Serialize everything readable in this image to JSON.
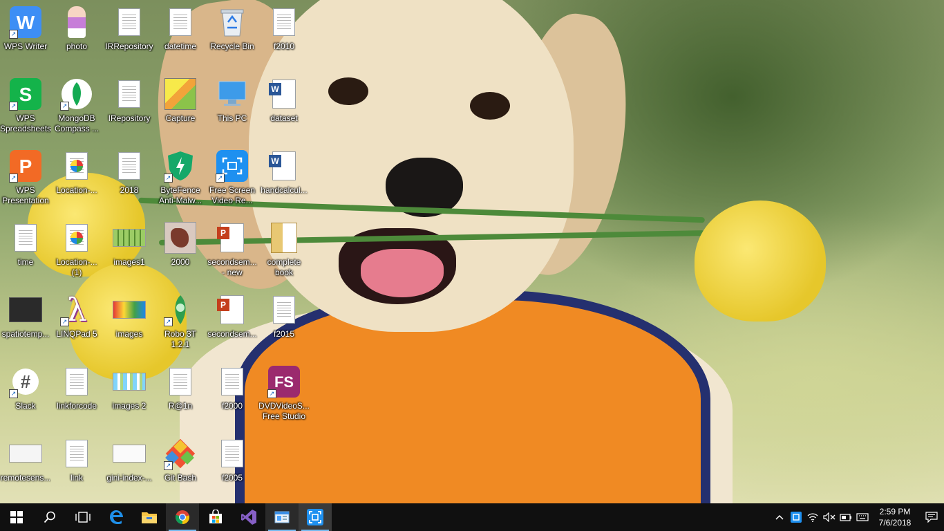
{
  "desktop": {
    "icons": [
      {
        "label": "WPS Writer"
      },
      {
        "label": "photo"
      },
      {
        "label": "IRRepository"
      },
      {
        "label": "datetime"
      },
      {
        "label": "Recycle Bin"
      },
      {
        "label": "f2010"
      },
      {
        "label": "WPS\nSpreadsheets"
      },
      {
        "label": "MongoDB\nCompass ..."
      },
      {
        "label": "IRepository"
      },
      {
        "label": "Capture"
      },
      {
        "label": "This PC"
      },
      {
        "label": "dataset"
      },
      {
        "label": "WPS\nPresentation"
      },
      {
        "label": "Location-..."
      },
      {
        "label": "2018"
      },
      {
        "label": "ByteFence\nAnti-Malw..."
      },
      {
        "label": "Free Screen\nVideo Re..."
      },
      {
        "label": "handcalcul..."
      },
      {
        "label": "time"
      },
      {
        "label": "Location-...\n(1)"
      },
      {
        "label": "images1"
      },
      {
        "label": "2000"
      },
      {
        "label": "secondsem...\n- new"
      },
      {
        "label": "complete\nbook"
      },
      {
        "label": "spatiotemp..."
      },
      {
        "label": "LINQPad 5"
      },
      {
        "label": "images"
      },
      {
        "label": "Robo 3T 1.2.1"
      },
      {
        "label": "secondsem..."
      },
      {
        "label": "f2015"
      },
      {
        "label": "Slack"
      },
      {
        "label": "linkforcode"
      },
      {
        "label": "images 2"
      },
      {
        "label": "R@1n"
      },
      {
        "label": "f2000"
      },
      {
        "label": "DVDVideoS...\nFree Studio"
      },
      {
        "label": "remotesens..."
      },
      {
        "label": "link"
      },
      {
        "label": "gini-index-..."
      },
      {
        "label": "Git Bash"
      },
      {
        "label": "f2005"
      }
    ],
    "tile_letters": {
      "wps_writer": "W",
      "wps_sheets": "S",
      "wps_pres": "P",
      "word": "W",
      "ppt": "P",
      "fs": "FS",
      "slack": "#",
      "linqpad": "λ",
      "shortcut": "↗"
    }
  },
  "taskbar": {
    "clock_time": "2:59 PM",
    "clock_date": "7/6/2018",
    "colors": {
      "accent": "#76b9ed",
      "background": "#101010"
    }
  }
}
